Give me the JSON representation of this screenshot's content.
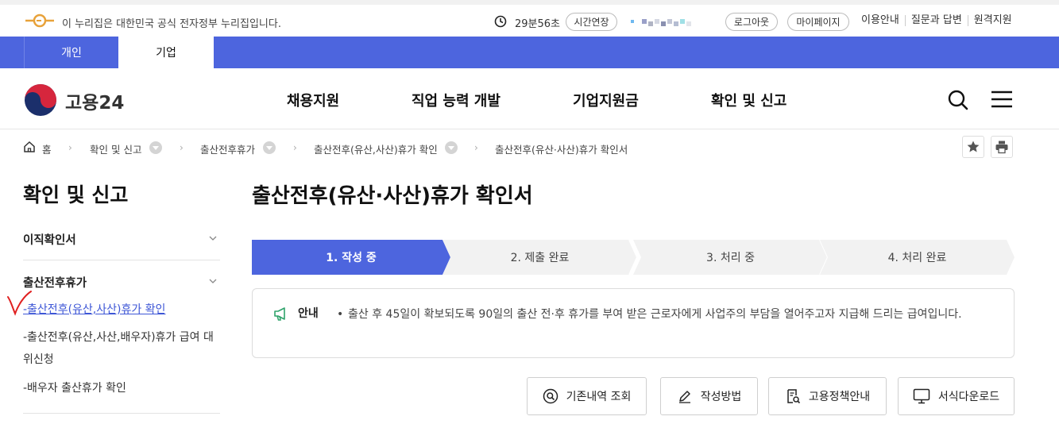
{
  "topbar": {
    "gov_notice": "이 누리집은 대한민국 공식 전자정부 누리집입니다.",
    "timer": "29분56초",
    "extend_label": "시간연장",
    "logout_label": "로그아웃",
    "mypage_label": "마이페이지",
    "links": [
      "이용안내",
      "질문과 답변",
      "원격지원"
    ]
  },
  "user_type_tabs": [
    "개인",
    "기업"
  ],
  "header": {
    "brand": "고용24",
    "nav": [
      "채용지원",
      "직업 능력 개발",
      "기업지원금",
      "확인 및 신고"
    ]
  },
  "breadcrumb": [
    "홈",
    "확인 및 신고",
    "출산전후휴가",
    "출산전후(유산,사산)휴가 확인",
    "출산전후(유산·사산)휴가 확인서"
  ],
  "sidebar": {
    "title": "확인 및 신고",
    "groups": [
      {
        "label": "이직확인서"
      },
      {
        "label": "출산전후휴가",
        "items": [
          "-출산전후(유산,사산)휴가 확인",
          "-출산전후(유산,사산,배우자)휴가 급여 대위신청",
          "-배우자 출산휴가 확인"
        ]
      }
    ]
  },
  "main": {
    "title": "출산전후(유산·사산)휴가 확인서",
    "steps": [
      "1. 작성 중",
      "2. 제출 완료",
      "3. 처리 중",
      "4. 처리 완료"
    ],
    "notice_label": "안내",
    "notice_text": "출산 후 45일이 확보되도록 90일의 출산 전·후 휴가를 부여 받은 근로자에게 사업주의 부담을 열어주고자 지급해 드리는 급여입니다.",
    "actions": [
      "기존내역 조회",
      "작성방법",
      "고용정책안내",
      "서식다운로드"
    ]
  },
  "colors": {
    "primary": "#4d65de",
    "active_link": "#3d56d6",
    "step_inactive": "#f2f2f2"
  }
}
